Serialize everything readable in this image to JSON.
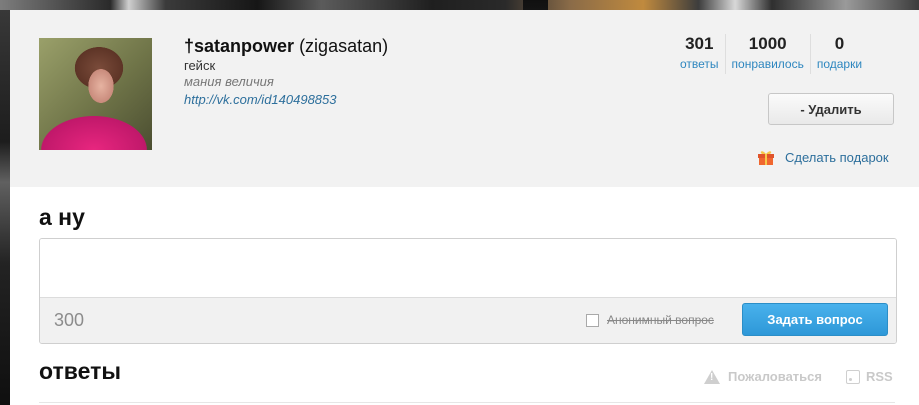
{
  "profile": {
    "username": "†satanpower",
    "nickname": "(zigasatan)",
    "status1": "гейск",
    "status2": "мания величия",
    "link": "http://vk.com/id140498853"
  },
  "stats": [
    {
      "value": "301",
      "label": "ответы"
    },
    {
      "value": "1000",
      "label": "понравилось"
    },
    {
      "value": "0",
      "label": "подарки"
    }
  ],
  "actions": {
    "delete_label": "- Удалить",
    "gift_label": "Сделать подарок",
    "gift_icon": "gift-icon"
  },
  "ask": {
    "title": "а ну",
    "input_value": "",
    "counter": "300",
    "anonymous_label": "Анонимный вопрос",
    "submit_label": "Задать вопрос"
  },
  "answers": {
    "title": "ответы",
    "report_label": "Пожаловаться",
    "rss_label": "RSS"
  },
  "colors": {
    "link": "#2d6f9c",
    "stat_label": "#2d86bf",
    "ask_button": "#3aa3e0",
    "profile_bg": "#f2f2f2"
  }
}
